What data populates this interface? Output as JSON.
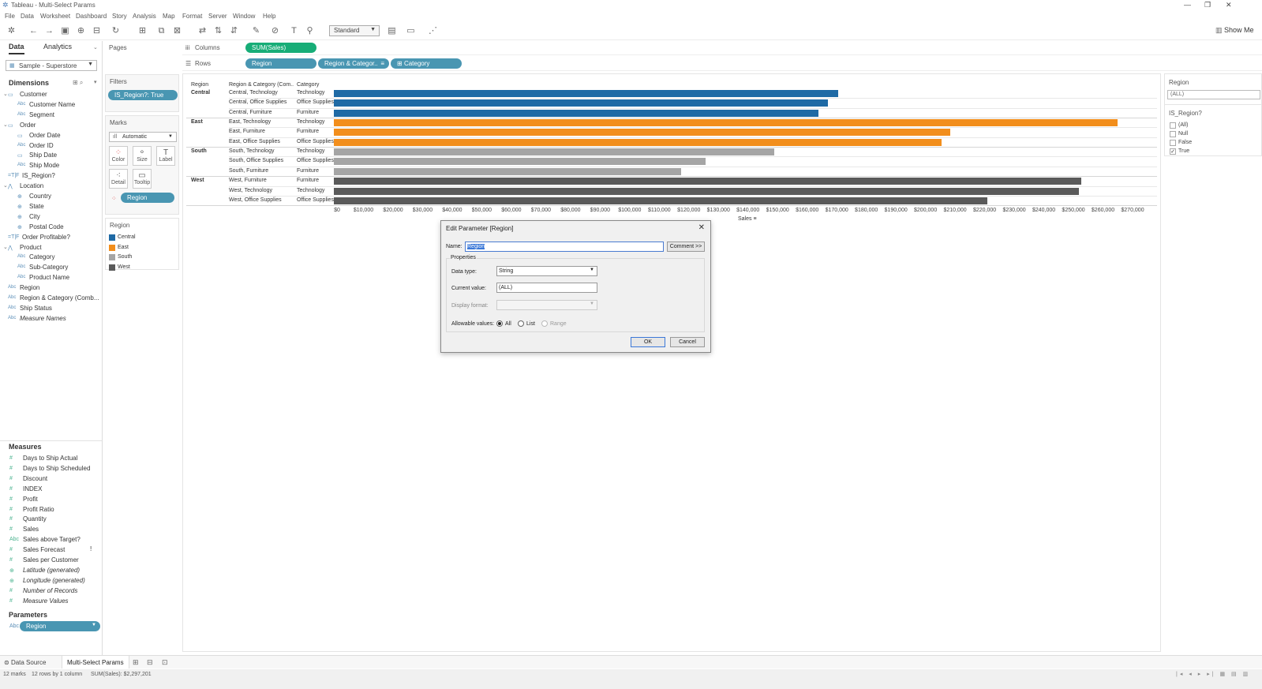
{
  "window": {
    "title": "Tableau - Multi-Select Params"
  },
  "menu": [
    "File",
    "Data",
    "Worksheet",
    "Dashboard",
    "Story",
    "Analysis",
    "Map",
    "Format",
    "Server",
    "Window",
    "Help"
  ],
  "toolbar": {
    "mark_type_select": "Standard",
    "show_me": "Show Me"
  },
  "data_pane": {
    "tab_data": "Data",
    "tab_analytics": "Analytics",
    "datasource": "Sample - Superstore",
    "dimensions_title": "Dimensions",
    "dimensions": [
      {
        "label": "Customer",
        "kind": "folder",
        "indent": 0
      },
      {
        "label": "Customer Name",
        "kind": "abc",
        "indent": 1
      },
      {
        "label": "Segment",
        "kind": "abc",
        "indent": 1
      },
      {
        "label": "Order",
        "kind": "folder",
        "indent": 0
      },
      {
        "label": "Order Date",
        "kind": "date",
        "indent": 1
      },
      {
        "label": "Order ID",
        "kind": "abc",
        "indent": 1
      },
      {
        "label": "Ship Date",
        "kind": "date",
        "indent": 1
      },
      {
        "label": "Ship Mode",
        "kind": "abc",
        "indent": 1
      },
      {
        "label": "IS_Region?",
        "kind": "tf",
        "indent": 0
      },
      {
        "label": "Location",
        "kind": "hier",
        "indent": 0
      },
      {
        "label": "Country",
        "kind": "geo",
        "indent": 1
      },
      {
        "label": "State",
        "kind": "geo",
        "indent": 1
      },
      {
        "label": "City",
        "kind": "geo",
        "indent": 1
      },
      {
        "label": "Postal Code",
        "kind": "geo",
        "indent": 1
      },
      {
        "label": "Order Profitable?",
        "kind": "tf",
        "indent": 0
      },
      {
        "label": "Product",
        "kind": "hier",
        "indent": 0
      },
      {
        "label": "Category",
        "kind": "abc",
        "indent": 1
      },
      {
        "label": "Sub-Category",
        "kind": "abc",
        "indent": 1
      },
      {
        "label": "Product Name",
        "kind": "abc",
        "indent": 1
      },
      {
        "label": "Region",
        "kind": "abc",
        "indent": 0
      },
      {
        "label": "Region & Category (Comb...",
        "kind": "abc",
        "indent": 0
      },
      {
        "label": "Ship Status",
        "kind": "abc",
        "indent": 0
      },
      {
        "label": "Measure Names",
        "kind": "abc",
        "indent": 0
      }
    ],
    "measures_title": "Measures",
    "measures": [
      {
        "label": "Days to Ship Actual",
        "kind": "num"
      },
      {
        "label": "Days to Ship Scheduled",
        "kind": "num"
      },
      {
        "label": "Discount",
        "kind": "num"
      },
      {
        "label": "INDEX",
        "kind": "num"
      },
      {
        "label": "Profit",
        "kind": "num"
      },
      {
        "label": "Profit Ratio",
        "kind": "num"
      },
      {
        "label": "Quantity",
        "kind": "num"
      },
      {
        "label": "Sales",
        "kind": "num"
      },
      {
        "label": "Sales above Target?",
        "kind": "abc"
      },
      {
        "label": "Sales Forecast",
        "kind": "num"
      },
      {
        "label": "Sales per Customer",
        "kind": "num"
      },
      {
        "label": "Latitude (generated)",
        "kind": "geo"
      },
      {
        "label": "Longitude (generated)",
        "kind": "geo"
      },
      {
        "label": "Number of Records",
        "kind": "num"
      },
      {
        "label": "Measure Values",
        "kind": "num"
      }
    ],
    "parameters_title": "Parameters",
    "parameter_pill": "Region"
  },
  "cards": {
    "pages": "Pages",
    "filters": "Filters",
    "filter_pill": "IS_Region?: True",
    "marks": "Marks",
    "marks_type": "Automatic",
    "mark_buttons": [
      "Color",
      "Size",
      "Label",
      "Detail",
      "Tooltip"
    ],
    "marks_pill": "Region",
    "legend_title": "Region",
    "legend": [
      {
        "label": "Central",
        "color": "#1f6aa5"
      },
      {
        "label": "East",
        "color": "#f28e1c"
      },
      {
        "label": "South",
        "color": "#a5a5a5"
      },
      {
        "label": "West",
        "color": "#5a5a5a"
      }
    ]
  },
  "shelves": {
    "columns_label": "Columns",
    "rows_label": "Rows",
    "columns_pill": "SUM(Sales)",
    "rows_pills": [
      "Region",
      "Region & Categor..",
      "Category"
    ]
  },
  "chart_data": {
    "type": "bar",
    "headers": [
      "Region",
      "Region & Category (Com..",
      "Category"
    ],
    "rows": [
      {
        "region": "Central",
        "combined": "Central, Technology",
        "category": "Technology",
        "value": 170400
      },
      {
        "region": "",
        "combined": "Central, Office Supplies",
        "category": "Office Supplies",
        "value": 167000
      },
      {
        "region": "",
        "combined": "Central, Furniture",
        "category": "Furniture",
        "value": 163800
      },
      {
        "region": "East",
        "combined": "East, Technology",
        "category": "Technology",
        "value": 264970
      },
      {
        "region": "",
        "combined": "East, Furniture",
        "category": "Furniture",
        "value": 208300
      },
      {
        "region": "",
        "combined": "East, Office Supplies",
        "category": "Office Supplies",
        "value": 205500
      },
      {
        "region": "South",
        "combined": "South, Technology",
        "category": "Technology",
        "value": 148800
      },
      {
        "region": "",
        "combined": "South, Office Supplies",
        "category": "Office Supplies",
        "value": 125700
      },
      {
        "region": "",
        "combined": "South, Furniture",
        "category": "Furniture",
        "value": 117300
      },
      {
        "region": "West",
        "combined": "West, Furniture",
        "category": "Furniture",
        "value": 252600
      },
      {
        "region": "",
        "combined": "West, Technology",
        "category": "Technology",
        "value": 251990
      },
      {
        "region": "",
        "combined": "West, Office Supplies",
        "category": "Office Supplies",
        "value": 220900
      }
    ],
    "colors": {
      "Central": "#1f6aa5",
      "East": "#f28e1c",
      "South": "#a5a5a5",
      "West": "#5a5a5a"
    },
    "xlim": [
      0,
      270000
    ],
    "xticks": [
      "$0",
      "$10,000",
      "$20,000",
      "$30,000",
      "$40,000",
      "$50,000",
      "$60,000",
      "$70,000",
      "$80,000",
      "$90,000",
      "$100,000",
      "$110,000",
      "$120,000",
      "$130,000",
      "$140,000",
      "$150,000",
      "$160,000",
      "$170,000",
      "$180,000",
      "$190,000",
      "$200,000",
      "$210,000",
      "$220,000",
      "$230,000",
      "$240,000",
      "$250,000",
      "$260,000",
      "$270,000"
    ],
    "xlabel": "Sales"
  },
  "filter_panel": {
    "region_title": "Region",
    "region_value": "(ALL)",
    "is_region_title": "IS_Region?",
    "options": [
      {
        "label": "(All)",
        "checked": false
      },
      {
        "label": "Null",
        "checked": false
      },
      {
        "label": "False",
        "checked": false
      },
      {
        "label": "True",
        "checked": true
      }
    ]
  },
  "dialog": {
    "title": "Edit Parameter [Region]",
    "name_label": "Name:",
    "name_value": "Region",
    "comment_button": "Comment >>",
    "properties": "Properties",
    "data_type_label": "Data type:",
    "data_type_value": "String",
    "current_value_label": "Current value:",
    "current_value": "(ALL)",
    "display_format_label": "Display format:",
    "allowable_label": "Allowable values:",
    "allowable_options": [
      "All",
      "List",
      "Range"
    ],
    "ok": "OK",
    "cancel": "Cancel"
  },
  "bottom_tabs": {
    "datasource": "Data Source",
    "sheet": "Multi-Select Params"
  },
  "status": {
    "marks": "12 marks",
    "rows": "12 rows by 1 column",
    "sum": "SUM(Sales): $2,297,201"
  }
}
